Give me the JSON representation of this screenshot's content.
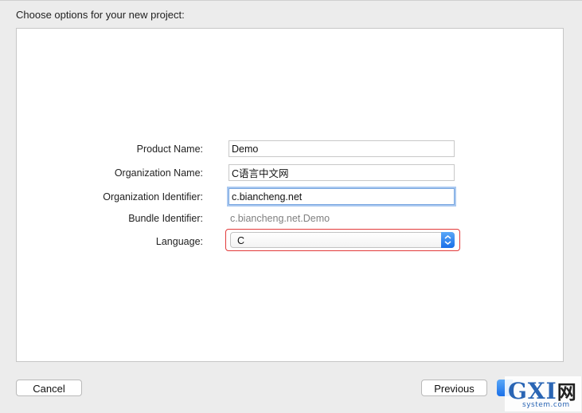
{
  "header": {
    "title": "Choose options for your new project:"
  },
  "form": {
    "product_name": {
      "label": "Product Name:",
      "value": "Demo"
    },
    "organization_name": {
      "label": "Organization Name:",
      "value": "C语言中文网"
    },
    "organization_identifier": {
      "label": "Organization Identifier:",
      "value": "c.biancheng.net"
    },
    "bundle_identifier": {
      "label": "Bundle Identifier:",
      "value": "c.biancheng.net.Demo"
    },
    "language": {
      "label": "Language:",
      "value": "C"
    }
  },
  "footer": {
    "cancel_label": "Cancel",
    "previous_label": "Previous"
  },
  "watermark": {
    "logo_text": "GXI",
    "logo_suffix": "网",
    "subtext": "system.com"
  },
  "colors": {
    "accent": "#1a6fe8",
    "focus_ring": "#a9c8f0",
    "annotation_red": "#e23a3a"
  }
}
